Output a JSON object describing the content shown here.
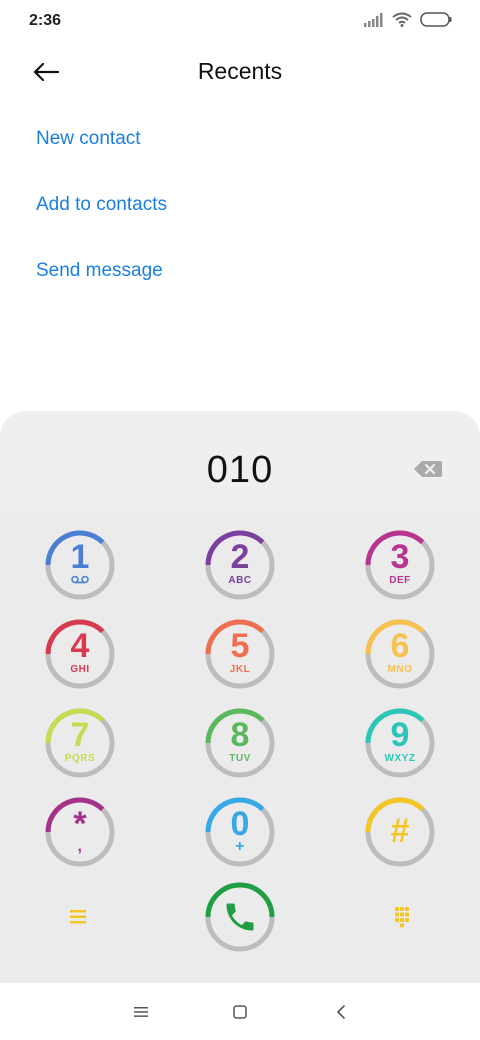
{
  "status_bar": {
    "time": "2:36"
  },
  "header": {
    "title": "Recents"
  },
  "actions": {
    "new_contact": "New contact",
    "add_to_contacts": "Add to contacts",
    "send_message": "Send message"
  },
  "dialer": {
    "number": "010",
    "keys": [
      {
        "digit": "1",
        "letters": "",
        "color": "#4a7fd4"
      },
      {
        "digit": "2",
        "letters": "ABC",
        "color": "#7b3f9e"
      },
      {
        "digit": "3",
        "letters": "DEF",
        "color": "#b8348f"
      },
      {
        "digit": "4",
        "letters": "GHI",
        "color": "#d63a4f"
      },
      {
        "digit": "5",
        "letters": "JKL",
        "color": "#ee6f4f"
      },
      {
        "digit": "6",
        "letters": "MNO",
        "color": "#f6c14e"
      },
      {
        "digit": "7",
        "letters": "PQRS",
        "color": "#c4dc52"
      },
      {
        "digit": "8",
        "letters": "TUV",
        "color": "#5cb85c"
      },
      {
        "digit": "9",
        "letters": "WXYZ",
        "color": "#2dc5b6"
      },
      {
        "digit": "*",
        "letters": ",",
        "color": "#a4328a"
      },
      {
        "digit": "0",
        "letters": "+",
        "color": "#37a8e6"
      },
      {
        "digit": "#",
        "letters": "",
        "color": "#f3c623"
      }
    ],
    "call_color": "#1f9e44",
    "accent_color": "#f3c623",
    "link_color": "#1a7fe0"
  }
}
